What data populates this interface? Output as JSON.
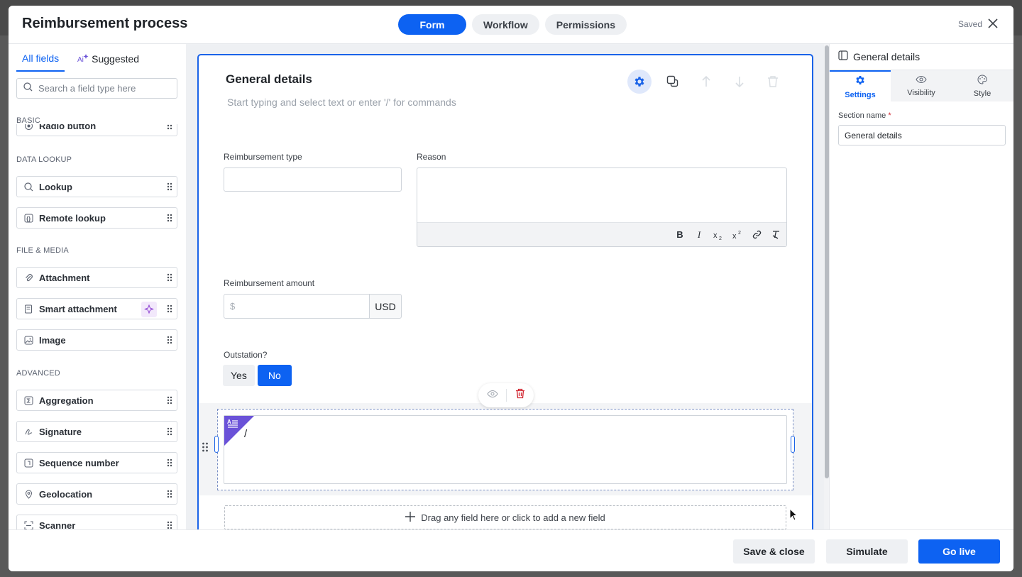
{
  "header": {
    "title": "Reimbursement process",
    "tabs": [
      "Form",
      "Workflow",
      "Permissions"
    ],
    "active_tab": "Form",
    "status": "Saved"
  },
  "left_panel": {
    "tabs": [
      "All fields",
      "Suggested"
    ],
    "search_placeholder": "Search a field type here",
    "sections": {
      "basic": {
        "title": "BASIC",
        "items": [
          "Radio button"
        ]
      },
      "data_lookup": {
        "title": "DATA LOOKUP",
        "items": [
          "Lookup",
          "Remote lookup"
        ]
      },
      "file_media": {
        "title": "FILE & MEDIA",
        "items": [
          "Attachment",
          "Smart attachment",
          "Image"
        ]
      },
      "advanced": {
        "title": "ADVANCED",
        "items": [
          "Aggregation",
          "Signature",
          "Sequence number",
          "Geolocation",
          "Scanner"
        ]
      }
    }
  },
  "canvas": {
    "section_title": "General details",
    "section_placeholder": "Start typing and select text or enter '/' for commands",
    "fields": {
      "reimbursement_type": {
        "label": "Reimbursement type",
        "value": ""
      },
      "reason": {
        "label": "Reason",
        "value": ""
      },
      "amount": {
        "label": "Reimbursement amount",
        "placeholder": "$",
        "currency": "USD"
      },
      "outstation": {
        "label": "Outstation?",
        "options": [
          "Yes",
          "No"
        ],
        "selected": "No"
      }
    },
    "rich_text_value": "/",
    "add_field_text": "Drag any field here or click to add a new field"
  },
  "right_panel": {
    "title": "General details",
    "tabs": [
      "Settings",
      "Visibility",
      "Style"
    ],
    "active_tab": "Settings",
    "section_name_label": "Section name",
    "section_name_value": "General details"
  },
  "footer": {
    "save_close": "Save & close",
    "simulate": "Simulate",
    "go_live": "Go live"
  },
  "colors": {
    "primary": "#0d62f2",
    "selected_border": "#1a63e8",
    "rich_text_badge": "#6a52d8"
  }
}
